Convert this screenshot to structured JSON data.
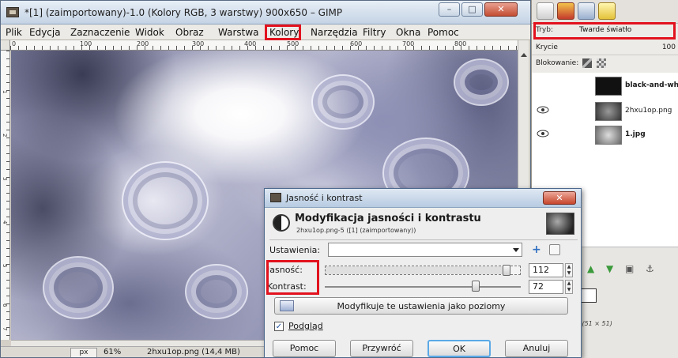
{
  "window": {
    "title": "*[1] (zaimportowany)-1.0 (Kolory RGB, 3 warstwy) 900x650 – GIMP",
    "btn_minimize": "–",
    "btn_maximize": "□",
    "btn_close": "✕"
  },
  "menu": {
    "items": [
      "Plik",
      "Edycja",
      "Zaznaczenie",
      "Widok",
      "Obraz",
      "Warstwa",
      "Kolory",
      "Narzędzia",
      "Filtry",
      "Okna",
      "Pomoc"
    ],
    "highlighted": "Kolory"
  },
  "ruler": {
    "h_labels": [
      "0",
      "100",
      "200",
      "300",
      "400",
      "500",
      "600",
      "700",
      "800"
    ],
    "v_labels": [
      "1",
      "2",
      "3",
      "4",
      "5",
      "6",
      "7"
    ]
  },
  "statusbar": {
    "unit": "px",
    "zoom": "61%",
    "text": "2hxu1op.png (14,4 MB)"
  },
  "dock": {
    "mode_label": "Tryb:",
    "mode_value": "Twarde światło",
    "opacity_label": "Krycie",
    "opacity_value": "100",
    "lock_label": "Blokowanie:",
    "layers": [
      {
        "name": "black-and-wh",
        "visible": false
      },
      {
        "name": "2hxu1op.png",
        "visible": true
      },
      {
        "name": "1.jpg",
        "visible": true
      }
    ],
    "brush_info": "Ho (51 × 51)"
  },
  "dialog": {
    "title": "Jasność i kontrast",
    "close": "✕",
    "header_title": "Modyfikacja jasności i kontrastu",
    "header_sub": "2hxu1op.png-5 ([1] (zaimportowany))",
    "presets_label": "Ustawienia:",
    "presets_value": "",
    "brightness_label": "Jasność:",
    "brightness_value": "112",
    "contrast_label": "Kontrast:",
    "contrast_value": "72",
    "slider_range": [
      -127,
      127
    ],
    "levels_button": "Modyfikuje te ustawienia jako poziomy",
    "preview_label": "Podgląd",
    "preview_checked": true,
    "buttons": {
      "help": "Pomoc",
      "reset": "Przywróć",
      "ok": "OK",
      "cancel": "Anuluj"
    }
  },
  "colors": {
    "highlight": "#e2121e",
    "accent": "#2e6ec0"
  }
}
